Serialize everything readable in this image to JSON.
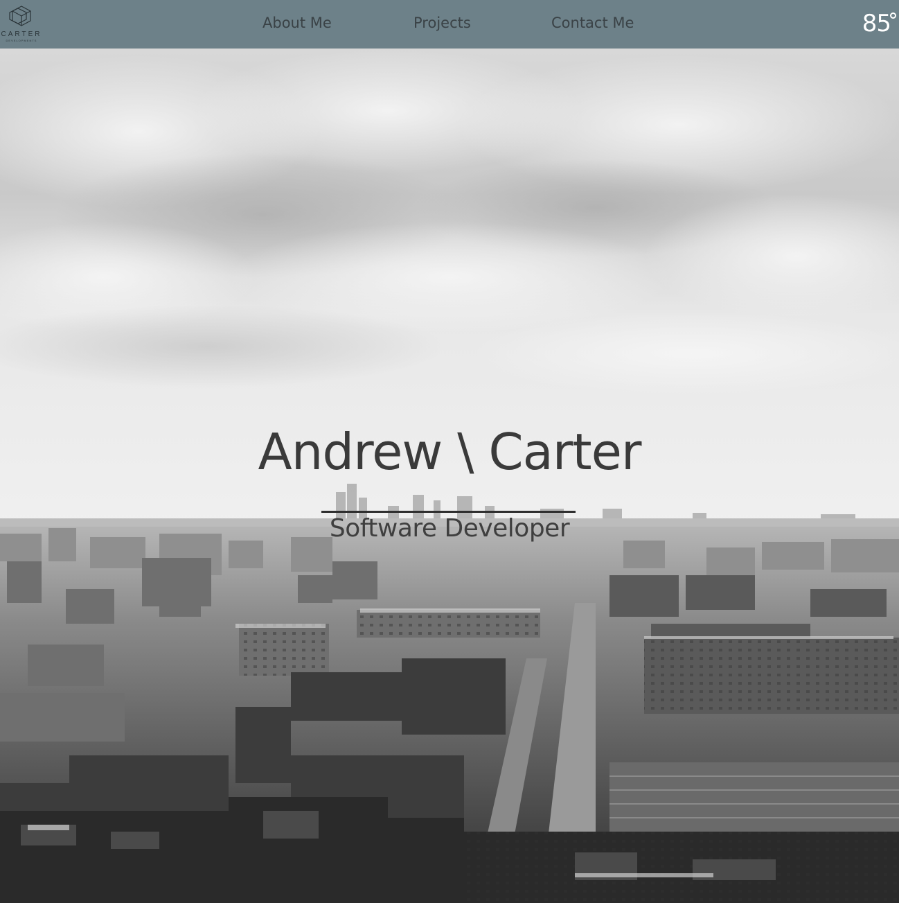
{
  "brand": {
    "logo_name": "CARTER",
    "logo_subtext": "DEVELOPMENTS"
  },
  "nav": {
    "items": [
      {
        "label": "About Me"
      },
      {
        "label": "Projects"
      },
      {
        "label": "Contact Me"
      }
    ]
  },
  "weather": {
    "temperature": "85"
  },
  "hero": {
    "title": "Andrew \\ Carter",
    "subtitle": "Software Developer"
  },
  "colors": {
    "header_bg": "#6d8189",
    "nav_text": "#3a4246",
    "title_text": "#3a3a3a"
  },
  "icons": {
    "logo": "cube-logo-icon",
    "degree": "degree-symbol-icon"
  }
}
